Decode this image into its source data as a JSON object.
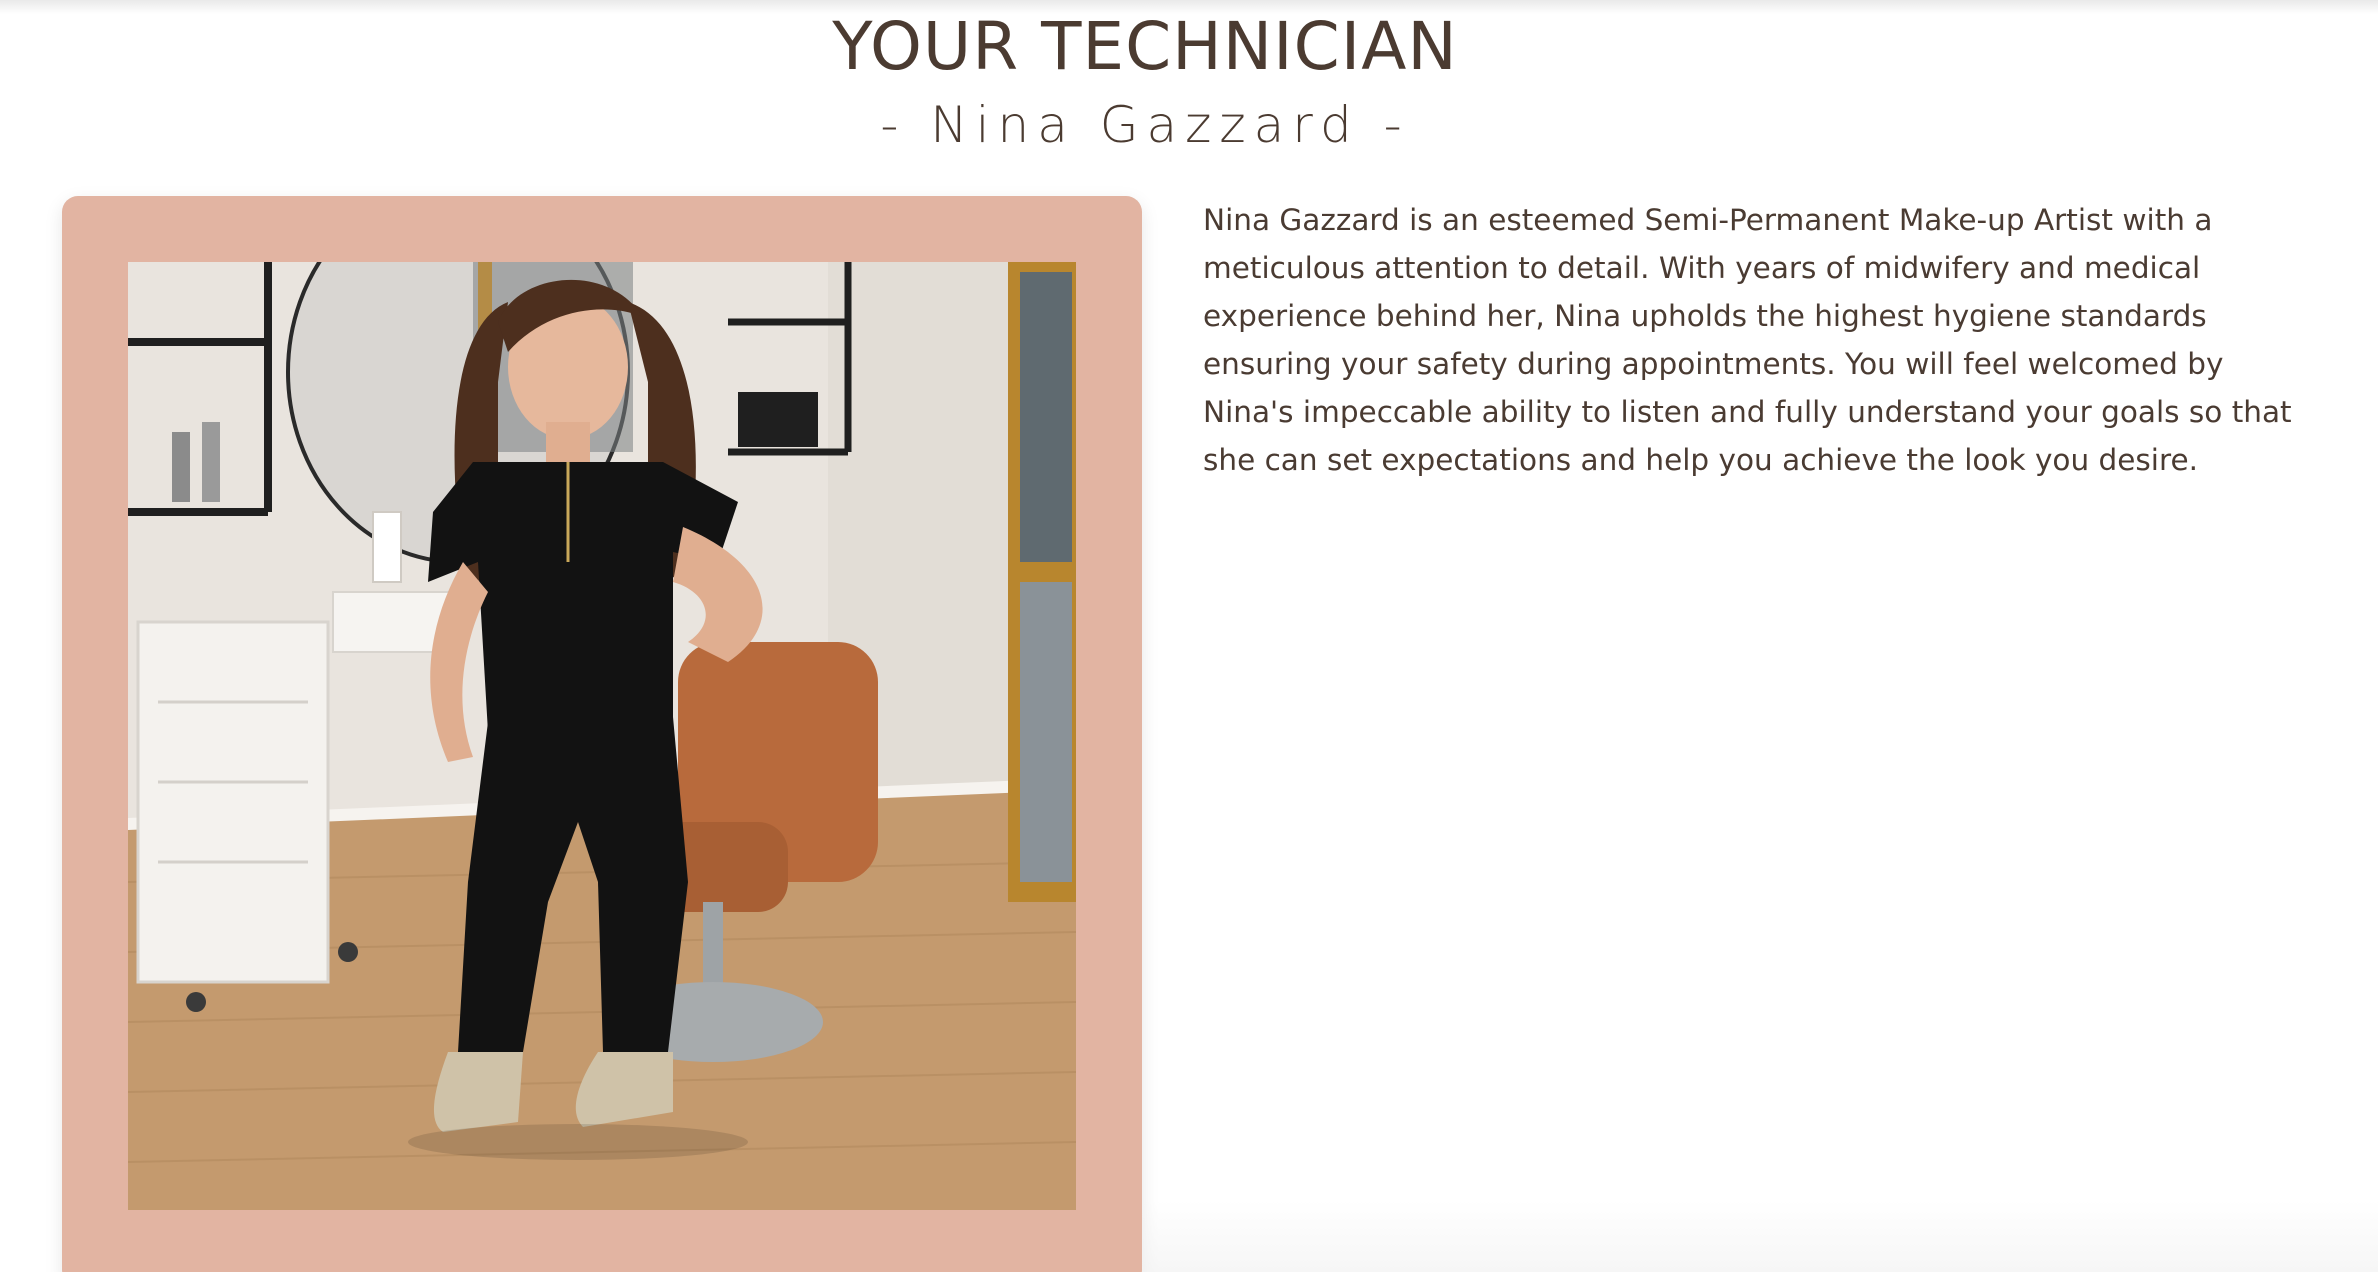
{
  "section": {
    "title": "YOUR TECHNICIAN",
    "subtitle": "- Nina Gazzard -"
  },
  "technician": {
    "bio": "Nina Gazzard is an esteemed Semi-Permanent Make-up Artist with a meticulous attention to detail. With years of midwifery and medical experience behind her, Nina upholds the highest hygiene standards ensuring your safety during appointments. You will feel welcomed by Nina's impeccable ability to listen and fully understand your goals so that she can set expectations and help you achieve the look you desire.",
    "photo_alt": "Nina Gazzard"
  },
  "colors": {
    "frame": "#e2b4a2",
    "heading": "#4b3b31",
    "text": "#4a3b32"
  }
}
